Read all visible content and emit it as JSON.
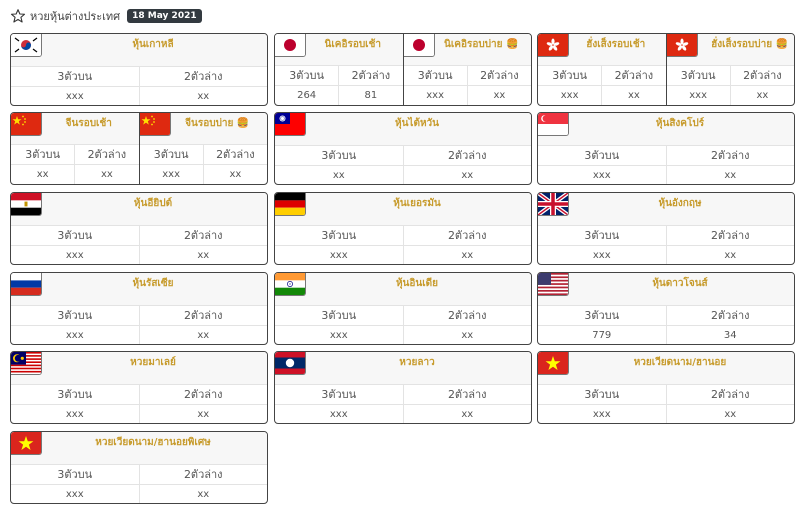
{
  "page": {
    "title": "หวยหุ้นต่างประเทศ",
    "date": "18 May 2021"
  },
  "labels": {
    "top": "3ตัวบน",
    "bottom": "2ตัวล่าง"
  },
  "lotteries": {
    "korea": {
      "name": "หุ้นเกาหลี",
      "top": "xxx",
      "bottom": "xx"
    },
    "nikkei_morning": {
      "name": "นิเคอิรอบเช้า",
      "top": "264",
      "bottom": "81"
    },
    "nikkei_afternoon": {
      "name": "นิเคอิรอบบ่าย 🍔",
      "top": "xxx",
      "bottom": "xx"
    },
    "hangseng_morning": {
      "name": "ฮั่งเส็งรอบเช้า",
      "top": "xxx",
      "bottom": "xx"
    },
    "hangseng_afternoon": {
      "name": "ฮั่งเส็งรอบบ่าย 🍔",
      "top": "xxx",
      "bottom": "xx"
    },
    "china_morning": {
      "name": "จีนรอบเช้า",
      "top": "xx",
      "bottom": "xx"
    },
    "china_afternoon": {
      "name": "จีนรอบบ่าย 🍔",
      "top": "xxx",
      "bottom": "xx"
    },
    "taiwan": {
      "name": "หุ้นไต้หวัน",
      "top": "xx",
      "bottom": "xx"
    },
    "singapore": {
      "name": "หุ้นสิงคโปร์",
      "top": "xxx",
      "bottom": "xx"
    },
    "egypt": {
      "name": "หุ้นอียิปต์",
      "top": "xxx",
      "bottom": "xx"
    },
    "germany": {
      "name": "หุ้นเยอรมัน",
      "top": "xxx",
      "bottom": "xx"
    },
    "england": {
      "name": "หุ้นอังกฤษ",
      "top": "xxx",
      "bottom": "xx"
    },
    "russia": {
      "name": "หุ้นรัสเซีย",
      "top": "xxx",
      "bottom": "xx"
    },
    "india": {
      "name": "หุ้นอินเดีย",
      "top": "xxx",
      "bottom": "xx"
    },
    "dowjones": {
      "name": "หุ้นดาวโจนส์",
      "top": "779",
      "bottom": "34"
    },
    "malaysia": {
      "name": "หวยมาเลย์",
      "top": "xxx",
      "bottom": "xx"
    },
    "laos": {
      "name": "หวยลาว",
      "top": "xxx",
      "bottom": "xx"
    },
    "vietnam": {
      "name": "หวยเวียดนาม/ฮานอย",
      "top": "xxx",
      "bottom": "xx"
    },
    "vietnam_special": {
      "name": "หวยเวียดนาม/ฮานอยพิเศษ",
      "top": "xxx",
      "bottom": "xx"
    }
  },
  "flags": {
    "korea": "korea-flag-icon",
    "japan": "japan-flag-icon",
    "hongkong": "hongkong-flag-icon",
    "china": "china-flag-icon",
    "taiwan": "taiwan-flag-icon",
    "singapore": "singapore-flag-icon",
    "egypt": "egypt-flag-icon",
    "germany": "germany-flag-icon",
    "uk": "uk-flag-icon",
    "russia": "russia-flag-icon",
    "india": "india-flag-icon",
    "usa": "usa-flag-icon",
    "malaysia": "malaysia-flag-icon",
    "laos": "laos-flag-icon",
    "vietnam": "vietnam-flag-icon"
  },
  "colors": {
    "accent": "#c79b2c",
    "badge_bg": "#333a40",
    "border": "#444444"
  }
}
